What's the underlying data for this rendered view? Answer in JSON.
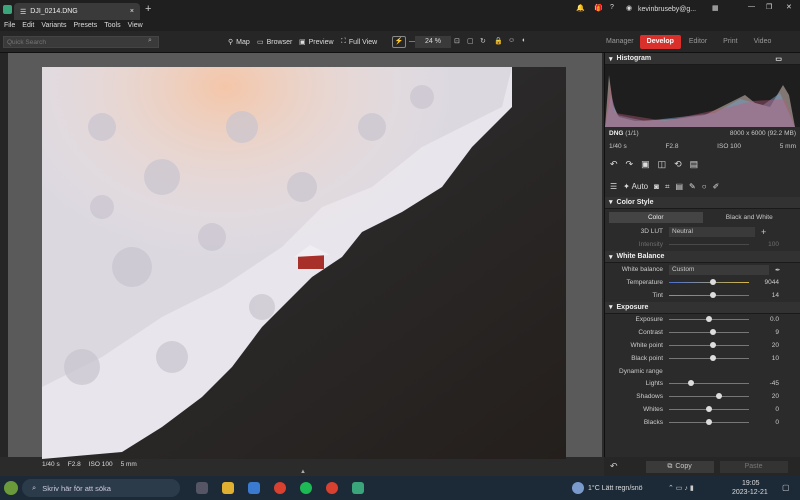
{
  "window": {
    "tab_title": "DJI_0214.DNG",
    "new_tab": "+",
    "user_email": "kevinbruseby@g..."
  },
  "menu": [
    "File",
    "Edit",
    "Variants",
    "Presets",
    "Tools",
    "View"
  ],
  "toolbar": {
    "search_placeholder": "Quick Search",
    "map": "Map",
    "browser": "Browser",
    "preview": "Preview",
    "full_view": "Full View",
    "zoom": "24 %",
    "modes": [
      "Manager",
      "Develop",
      "Editor",
      "Print",
      "Video"
    ],
    "active_mode": "Develop"
  },
  "photo_caption": {
    "shutter": "1/40 s",
    "aperture": "F2.8",
    "iso": "ISO 100",
    "focal": "5 mm"
  },
  "histogram": {
    "title": "Histogram",
    "format": "DNG",
    "count": "(1/1)",
    "dims": "8000 x 6000 (92.2 MB)",
    "shutter": "1/40 s",
    "aperture": "F2.8",
    "iso": "ISO 100",
    "focal": "5 mm"
  },
  "tools": {
    "auto": "Auto"
  },
  "color_style": {
    "title": "Color Style",
    "tab_color": "Color",
    "tab_bw": "Black and White",
    "lut_label": "3D LUT",
    "lut_value": "Neutral",
    "intensity_label": "Intensity",
    "intensity_value": "100"
  },
  "white_balance": {
    "title": "White Balance",
    "wb_label": "White balance",
    "wb_value": "Custom",
    "temp_label": "Temperature",
    "temp_value": "9044",
    "temp_pos": 0.55,
    "tint_label": "Tint",
    "tint_value": "14",
    "tint_pos": 0.55
  },
  "exposure": {
    "title": "Exposure",
    "rows": [
      {
        "label": "Exposure",
        "value": "0.0",
        "pos": 0.5
      },
      {
        "label": "Contrast",
        "value": "9",
        "pos": 0.55
      },
      {
        "label": "White point",
        "value": "20",
        "pos": 0.55
      },
      {
        "label": "Black point",
        "value": "10",
        "pos": 0.55
      }
    ],
    "dynamic_range": "Dynamic range",
    "dr_rows": [
      {
        "label": "Lights",
        "value": "-45",
        "pos": 0.28
      },
      {
        "label": "Shadows",
        "value": "20",
        "pos": 0.62
      },
      {
        "label": "Whites",
        "value": "0",
        "pos": 0.5
      },
      {
        "label": "Blacks",
        "value": "0",
        "pos": 0.5
      }
    ]
  },
  "bottom_bar": {
    "copy": "Copy",
    "paste": "Paste"
  },
  "taskbar": {
    "search": "Skriv här för att söka",
    "weather": "1°C  Lätt regn/snö",
    "time": "19:05",
    "date": "2023-12-21"
  },
  "colors": {
    "accent": "#d9302b",
    "panel": "#2b2b2b"
  }
}
